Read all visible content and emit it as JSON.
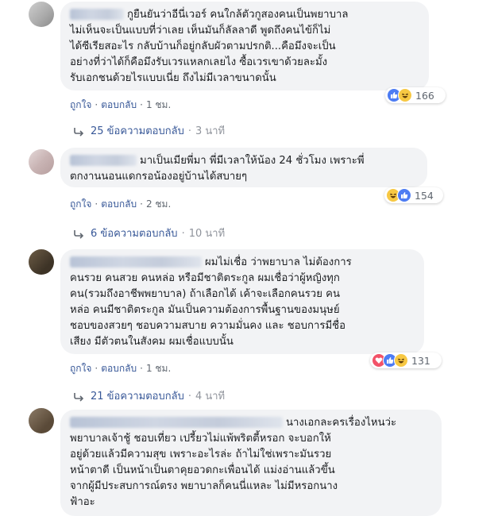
{
  "comments": [
    {
      "lines": [
        "กูยืนยันว่าอีนี่เวอร์ คนใกล้ตัวกูสองคนเป็นพยาบาล",
        "ไม่เห็นจะเป็นแบบที่ว่าเลย เห็นมันก็ลัลลาดี พูดถึงคนไข้ก็ไม่",
        "ได้ซีเรียสอะไร กลับบ้านก็อยู่กลับผัวตามปรกติ...คือมึงจะเป็น",
        "อย่างที่ว่าได้ก็คือมึงรับเวรแหลกเลยไง ซื้อเวรเขาด้วยละมั้ง",
        "รับเอกชนด้วยไรแบบเนี่ย ถึงไม่มีเวลาขนาดนั้น"
      ],
      "like_label": "ถูกใจ",
      "reply_label": "ตอบกลับ",
      "time": "1 ชม.",
      "reaction_count": "166",
      "reaction_icons": [
        "like-icon",
        "haha-icon"
      ],
      "replies_label": "25 ข้อความตอบกลับ",
      "replies_time": "3 นาที"
    },
    {
      "lines": [
        "มาเป็นเมียพี่มา พี่มีเวลาให้น้อง 24 ชั่วโมง เพราะพี่",
        "ตกงานนอนแดกรอน้องอยู่บ้านได้สบายๆ"
      ],
      "like_label": "ถูกใจ",
      "reply_label": "ตอบกลับ",
      "time": "2 ชม.",
      "reaction_count": "154",
      "reaction_icons": [
        "haha-icon",
        "like-icon"
      ],
      "replies_label": "6 ข้อความตอบกลับ",
      "replies_time": "10 นาที"
    },
    {
      "lines": [
        "ผมไม่เชื่อ ว่าพยาบาล ไม่ต้องการ",
        "คนรวย คนสวย คนหล่อ หรือมีชาติตระกูล ผมเชื่อว่าผู้หญิงทุก",
        "คน(รวมถึงอาชีพพยาบาล) ถ้าเลือกได้ เค้าจะเลือกคนรวย คน",
        "หล่อ คนมีชาติตระกูล มันเป็นความต้องการพื้นฐานของมนุษย์",
        "ชอบของสวยๆ ชอบความสบาย ความมั่นคง และ ชอบการมีชื่อ",
        "เสียง มีตัวตนในสังคม ผมเชื่อแบบนั้น"
      ],
      "like_label": "ถูกใจ",
      "reply_label": "ตอบกลับ",
      "time": "1 ชม.",
      "reaction_count": "131",
      "reaction_icons": [
        "love-icon",
        "like-icon",
        "haha-icon"
      ],
      "replies_label": "21 ข้อความตอบกลับ",
      "replies_time": "4 นาที"
    },
    {
      "lines": [
        "นางเอกละครเรื่องไหนว่ะ",
        "พยาบาลเจ้าชู้ ชอบเที่ยว เปรี้ยวไม่แพ้พริตตี้หรอก จะบอกให้",
        "อยู่ด้วยแล้วมีความสุข เพราะอะไรล่ะ ถ้าไม่ใช่เพราะมันรวย",
        "หน้าตาดี เป็นหน้าเป็นตาคุยอวดกะเพื่อนได้ แม่งอ่านแล้วขึ้น",
        "จากผู้มีประสบการณ์ตรง พยาบาลก็คนนี่แหละ ไม่มีหรอกนาง",
        "ฟ้าอะ"
      ]
    }
  ]
}
